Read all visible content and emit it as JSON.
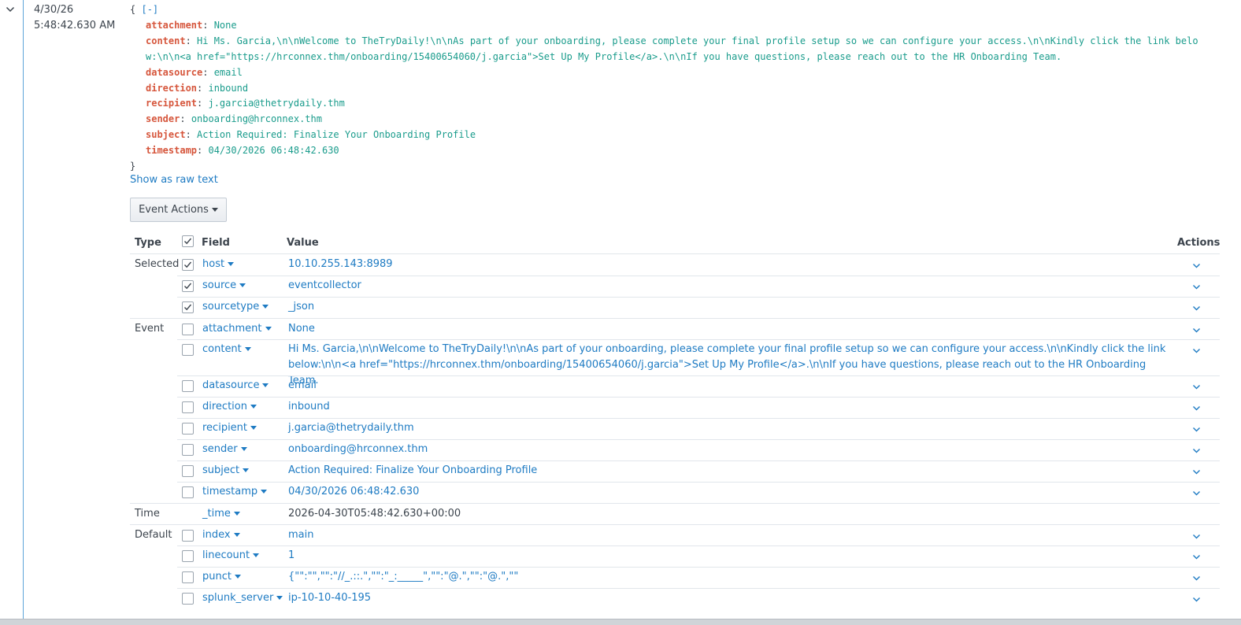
{
  "event": {
    "date": "4/30/26",
    "time": "5:48:42.630 AM",
    "json_open": "{",
    "collapse": "[-]",
    "json_close": "}",
    "fields": [
      {
        "key": "attachment",
        "value": "None"
      },
      {
        "key": "content",
        "value": "Hi Ms. Garcia,\\n\\nWelcome to TheTryDaily!\\n\\nAs part of your onboarding, please complete your final profile setup so we can configure your access.\\n\\nKindly click the link below:\\n\\n<a href=\"https://hrconnex.thm/onboarding/15400654060/j.garcia\">Set Up My Profile</a>.\\n\\nIf you have questions, please reach out to the HR Onboarding Team."
      },
      {
        "key": "datasource",
        "value": "email"
      },
      {
        "key": "direction",
        "value": "inbound"
      },
      {
        "key": "recipient",
        "value": "j.garcia@thetrydaily.thm"
      },
      {
        "key": "sender",
        "value": "onboarding@hrconnex.thm"
      },
      {
        "key": "subject",
        "value": "Action Required: Finalize Your Onboarding Profile"
      },
      {
        "key": "timestamp",
        "value": "04/30/2026 06:48:42.630"
      }
    ],
    "show_raw": "Show as raw text",
    "event_actions": "Event Actions"
  },
  "table": {
    "headers": {
      "type": "Type",
      "field": "Field",
      "value": "Value",
      "actions": "Actions"
    },
    "groups": {
      "selected": "Selected",
      "event": "Event",
      "time": "Time",
      "default": "Default"
    },
    "rows": [
      {
        "field": "host",
        "value": "10.10.255.143:8989",
        "checked": true
      },
      {
        "field": "source",
        "value": "eventcollector",
        "checked": true
      },
      {
        "field": "sourcetype",
        "value": "_json",
        "checked": true
      },
      {
        "field": "attachment",
        "value": "None",
        "checked": false
      },
      {
        "field": "content",
        "value": "Hi Ms. Garcia,\\n\\nWelcome to TheTryDaily!\\n\\nAs part of your onboarding, please complete your final profile setup so we can configure your access.\\n\\nKindly click the link below:\\n\\n<a href=\"https://hrconnex.thm/onboarding/15400654060/j.garcia\">Set Up My Profile</a>.\\n\\nIf you have questions, please reach out to the HR Onboarding Team.",
        "checked": false
      },
      {
        "field": "datasource",
        "value": "email",
        "checked": false
      },
      {
        "field": "direction",
        "value": "inbound",
        "checked": false
      },
      {
        "field": "recipient",
        "value": "j.garcia@thetrydaily.thm",
        "checked": false
      },
      {
        "field": "sender",
        "value": "onboarding@hrconnex.thm",
        "checked": false
      },
      {
        "field": "subject",
        "value": "Action Required: Finalize Your Onboarding Profile",
        "checked": false
      },
      {
        "field": "timestamp",
        "value": "04/30/2026 06:48:42.630",
        "checked": false
      },
      {
        "field": "_time",
        "value": "2026-04-30T05:48:42.630+00:00"
      },
      {
        "field": "index",
        "value": "main",
        "checked": false
      },
      {
        "field": "linecount",
        "value": "1",
        "checked": false
      },
      {
        "field": "punct",
        "value": "{\"\":\"\",\"\":\"//_.::.\",\"\":\"_:_____\",\"\":\"@.\",\"\":\"@.\",\"\"",
        "checked": false
      },
      {
        "field": "splunk_server",
        "value": "ip-10-10-40-195",
        "checked": false
      }
    ]
  }
}
